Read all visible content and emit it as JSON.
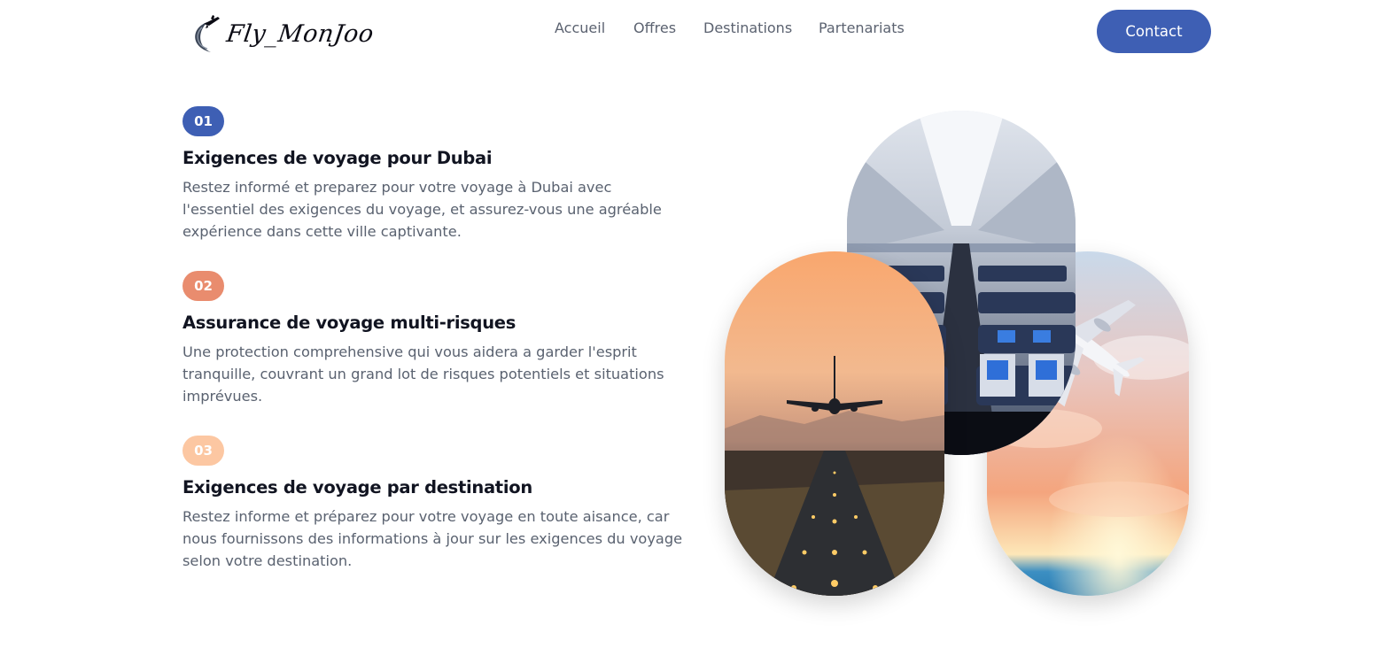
{
  "brand": {
    "name": "Fly_MonJoo"
  },
  "nav": {
    "items": [
      {
        "label": "Accueil"
      },
      {
        "label": "Offres"
      },
      {
        "label": "Destinations"
      },
      {
        "label": "Partenariats"
      }
    ],
    "contact_label": "Contact"
  },
  "features": [
    {
      "number": "01",
      "title": "Exigences de voyage pour Dubai",
      "description": "Restez informé et preparez pour votre voyage à Dubai avec l'essentiel des exigences du voyage, et assurez-vous une agréable expérience dans cette ville captivante.",
      "badge_color": "#3e5fb4"
    },
    {
      "number": "02",
      "title": "Assurance de voyage multi-risques",
      "description": "Une protection comprehensive qui vous aidera a garder l'esprit tranquille, couvrant un grand lot de risques potentiels et situations imprévues.",
      "badge_color": "#e98c6e"
    },
    {
      "number": "03",
      "title": "Exigences de voyage par destination",
      "description": "Restez informe et préparez pour votre voyage en toute aisance, car nous fournissons des informations à jour sur les exigences du voyage selon votre destination.",
      "badge_color": "#fcc7a2"
    }
  ],
  "colors": {
    "accent": "#3e5fb4",
    "heading": "#111421",
    "body_text": "#5a6270"
  }
}
